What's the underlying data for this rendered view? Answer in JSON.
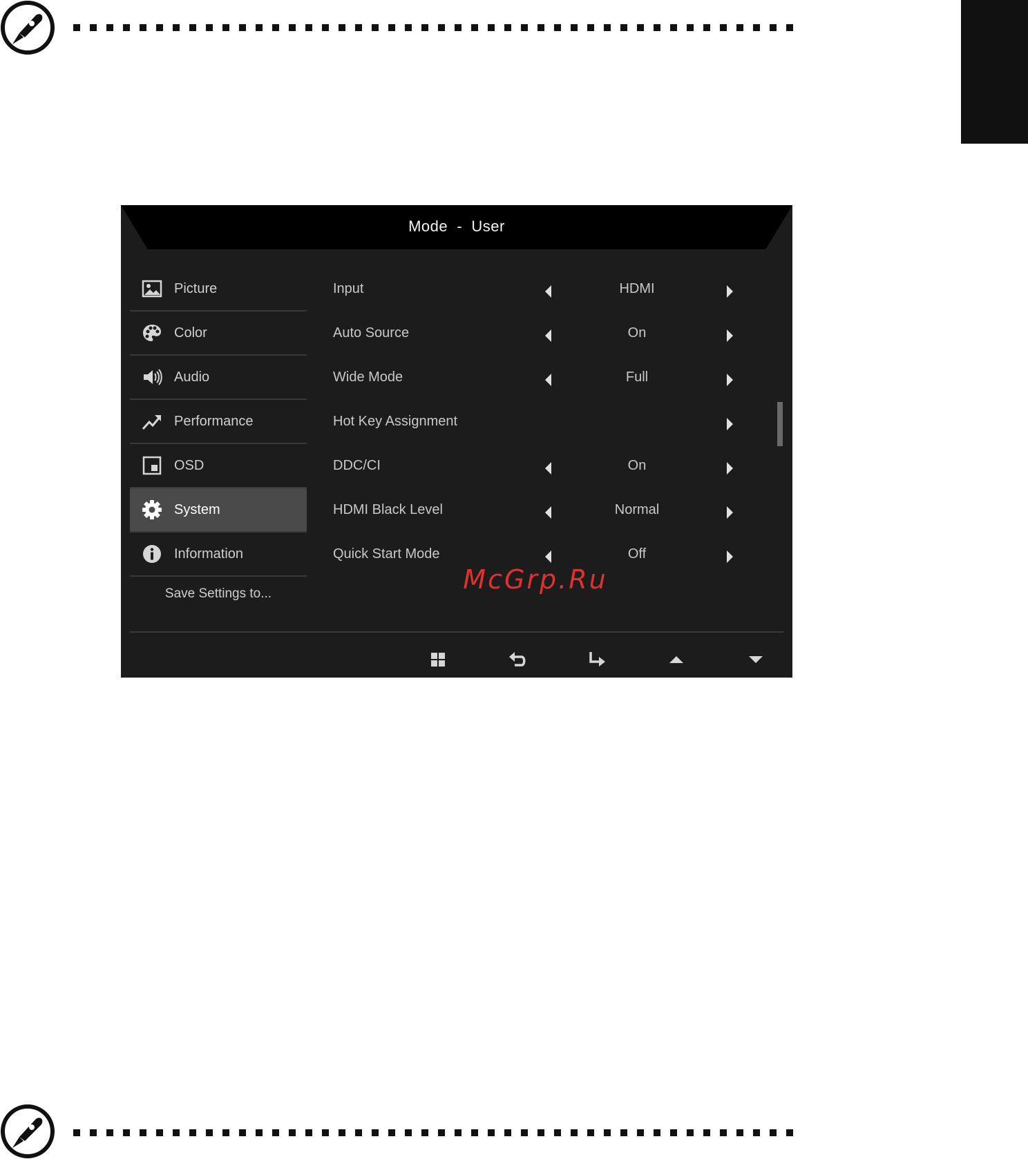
{
  "osd": {
    "title": "Mode  -  User",
    "menu": [
      {
        "label": "Picture",
        "icon": "picture-icon",
        "active": false
      },
      {
        "label": "Color",
        "icon": "palette-icon",
        "active": false
      },
      {
        "label": "Audio",
        "icon": "speaker-icon",
        "active": false
      },
      {
        "label": "Performance",
        "icon": "trend-up-icon",
        "active": false
      },
      {
        "label": "OSD",
        "icon": "osd-icon",
        "active": false
      },
      {
        "label": "System",
        "icon": "gear-icon",
        "active": true
      },
      {
        "label": "Information",
        "icon": "info-icon",
        "active": false
      }
    ],
    "save_settings": "Save Settings to...",
    "settings": [
      {
        "label": "Input",
        "value": "HDMI"
      },
      {
        "label": "Auto Source",
        "value": "On"
      },
      {
        "label": "Wide Mode",
        "value": "Full"
      },
      {
        "label": "Hot Key Assignment",
        "value": ""
      },
      {
        "label": "DDC/CI",
        "value": "On"
      },
      {
        "label": "HDMI Black Level",
        "value": "Normal"
      },
      {
        "label": "Quick Start Mode",
        "value": "Off"
      }
    ],
    "footer_buttons": [
      "menu-grid-icon",
      "back-icon",
      "enter-icon",
      "up-arrow-icon",
      "down-arrow-icon"
    ]
  },
  "watermark": "McGrp.Ru",
  "colors": {
    "osd_background": "#1c1c1c",
    "header_background": "#000000",
    "active_item": "#4a4a4a",
    "watermark": "#e0312e"
  }
}
